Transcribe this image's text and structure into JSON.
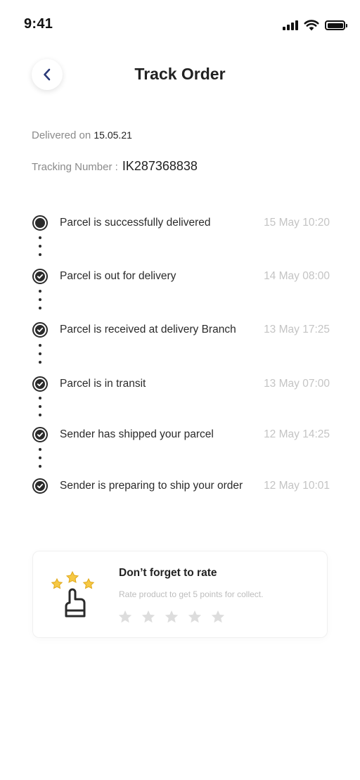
{
  "status_bar": {
    "time": "9:41"
  },
  "header": {
    "title": "Track Order"
  },
  "order": {
    "delivered_label": "Delivered on ",
    "delivered_date": "15.05.21",
    "tracking_label": "Tracking Number :",
    "tracking_number": "IK287368838"
  },
  "timeline": [
    {
      "label": "Parcel is successfully delivered",
      "time": "15 May 10:20",
      "state": "current"
    },
    {
      "label": "Parcel is out for delivery",
      "time": "14 May 08:00",
      "state": "done"
    },
    {
      "label": "Parcel is received at delivery Branch",
      "time": "13 May 17:25",
      "state": "done"
    },
    {
      "label": "Parcel is in transit",
      "time": "13 May 07:00",
      "state": "done"
    },
    {
      "label": "Sender has shipped your parcel",
      "time": "12 May 14:25",
      "state": "done"
    },
    {
      "label": "Sender is preparing to ship your order",
      "time": "12 May 10:01",
      "state": "done"
    }
  ],
  "rate_card": {
    "title": "Don’t forget to rate",
    "subtitle": "Rate product to get 5 points for collect.",
    "stars_total": 5,
    "stars_selected": 0,
    "icon": "rate-hand-stars-icon"
  },
  "colors": {
    "accent_star": "#f6c844",
    "inactive_star": "#dddddd",
    "text_primary": "#2b2b2b",
    "text_muted": "#c4c4c4"
  }
}
